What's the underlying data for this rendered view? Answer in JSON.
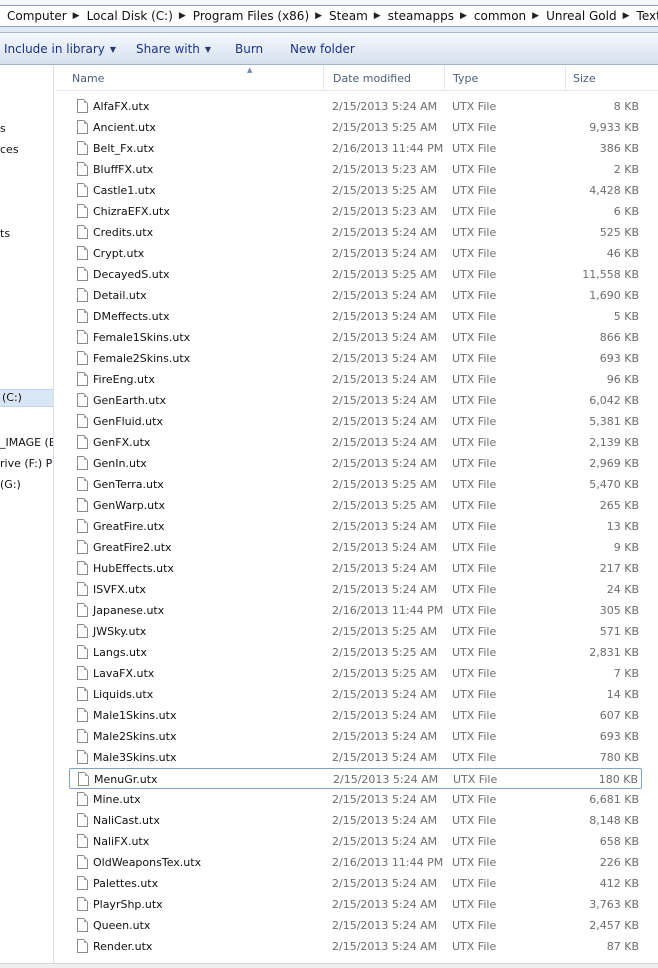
{
  "breadcrumb": [
    "Computer",
    "Local Disk (C:)",
    "Program Files (x86)",
    "Steam",
    "steamapps",
    "common",
    "Unreal Gold",
    "Textures"
  ],
  "commands": [
    {
      "label": "Include in library",
      "dropdown": true
    },
    {
      "label": "Share with",
      "dropdown": true
    },
    {
      "label": "Burn",
      "dropdown": false
    },
    {
      "label": "New folder",
      "dropdown": false
    }
  ],
  "nav": {
    "items": [
      {
        "label": "s"
      },
      {
        "label": "ces"
      },
      {
        "label": "ts"
      },
      {
        "label": "(C:)",
        "selected": true
      },
      {
        "label": "_IMAGE (E"
      },
      {
        "label": "rive (F:) Pl"
      },
      {
        "label": "(G:)"
      }
    ]
  },
  "columns": {
    "name": "Name",
    "date": "Date modified",
    "type": "Type",
    "size": "Size"
  },
  "files": [
    {
      "name": "AlfaFX.utx",
      "date": "2/15/2013 5:24 AM",
      "type": "UTX File",
      "size": "8 KB"
    },
    {
      "name": "Ancient.utx",
      "date": "2/15/2013 5:25 AM",
      "type": "UTX File",
      "size": "9,933 KB"
    },
    {
      "name": "Belt_Fx.utx",
      "date": "2/16/2013 11:44 PM",
      "type": "UTX File",
      "size": "386 KB"
    },
    {
      "name": "BluffFX.utx",
      "date": "2/15/2013 5:23 AM",
      "type": "UTX File",
      "size": "2 KB"
    },
    {
      "name": "Castle1.utx",
      "date": "2/15/2013 5:25 AM",
      "type": "UTX File",
      "size": "4,428 KB"
    },
    {
      "name": "ChizraEFX.utx",
      "date": "2/15/2013 5:23 AM",
      "type": "UTX File",
      "size": "6 KB"
    },
    {
      "name": "Credits.utx",
      "date": "2/15/2013 5:24 AM",
      "type": "UTX File",
      "size": "525 KB"
    },
    {
      "name": "Crypt.utx",
      "date": "2/15/2013 5:24 AM",
      "type": "UTX File",
      "size": "46 KB"
    },
    {
      "name": "DecayedS.utx",
      "date": "2/15/2013 5:25 AM",
      "type": "UTX File",
      "size": "11,558 KB"
    },
    {
      "name": "Detail.utx",
      "date": "2/15/2013 5:24 AM",
      "type": "UTX File",
      "size": "1,690 KB"
    },
    {
      "name": "DMeffects.utx",
      "date": "2/15/2013 5:24 AM",
      "type": "UTX File",
      "size": "5 KB"
    },
    {
      "name": "Female1Skins.utx",
      "date": "2/15/2013 5:24 AM",
      "type": "UTX File",
      "size": "866 KB"
    },
    {
      "name": "Female2Skins.utx",
      "date": "2/15/2013 5:24 AM",
      "type": "UTX File",
      "size": "693 KB"
    },
    {
      "name": "FireEng.utx",
      "date": "2/15/2013 5:24 AM",
      "type": "UTX File",
      "size": "96 KB"
    },
    {
      "name": "GenEarth.utx",
      "date": "2/15/2013 5:24 AM",
      "type": "UTX File",
      "size": "6,042 KB"
    },
    {
      "name": "GenFluid.utx",
      "date": "2/15/2013 5:24 AM",
      "type": "UTX File",
      "size": "5,381 KB"
    },
    {
      "name": "GenFX.utx",
      "date": "2/15/2013 5:24 AM",
      "type": "UTX File",
      "size": "2,139 KB"
    },
    {
      "name": "GenIn.utx",
      "date": "2/15/2013 5:24 AM",
      "type": "UTX File",
      "size": "2,969 KB"
    },
    {
      "name": "GenTerra.utx",
      "date": "2/15/2013 5:25 AM",
      "type": "UTX File",
      "size": "5,470 KB"
    },
    {
      "name": "GenWarp.utx",
      "date": "2/15/2013 5:25 AM",
      "type": "UTX File",
      "size": "265 KB"
    },
    {
      "name": "GreatFire.utx",
      "date": "2/15/2013 5:24 AM",
      "type": "UTX File",
      "size": "13 KB"
    },
    {
      "name": "GreatFire2.utx",
      "date": "2/15/2013 5:24 AM",
      "type": "UTX File",
      "size": "9 KB"
    },
    {
      "name": "HubEffects.utx",
      "date": "2/15/2013 5:24 AM",
      "type": "UTX File",
      "size": "217 KB"
    },
    {
      "name": "ISVFX.utx",
      "date": "2/15/2013 5:24 AM",
      "type": "UTX File",
      "size": "24 KB"
    },
    {
      "name": "Japanese.utx",
      "date": "2/16/2013 11:44 PM",
      "type": "UTX File",
      "size": "305 KB"
    },
    {
      "name": "JWSky.utx",
      "date": "2/15/2013 5:25 AM",
      "type": "UTX File",
      "size": "571 KB"
    },
    {
      "name": "Langs.utx",
      "date": "2/15/2013 5:25 AM",
      "type": "UTX File",
      "size": "2,831 KB"
    },
    {
      "name": "LavaFX.utx",
      "date": "2/15/2013 5:25 AM",
      "type": "UTX File",
      "size": "7 KB"
    },
    {
      "name": "Liquids.utx",
      "date": "2/15/2013 5:24 AM",
      "type": "UTX File",
      "size": "14 KB"
    },
    {
      "name": "Male1Skins.utx",
      "date": "2/15/2013 5:24 AM",
      "type": "UTX File",
      "size": "607 KB"
    },
    {
      "name": "Male2Skins.utx",
      "date": "2/15/2013 5:24 AM",
      "type": "UTX File",
      "size": "693 KB"
    },
    {
      "name": "Male3Skins.utx",
      "date": "2/15/2013 5:24 AM",
      "type": "UTX File",
      "size": "780 KB"
    },
    {
      "name": "MenuGr.utx",
      "date": "2/15/2013 5:24 AM",
      "type": "UTX File",
      "size": "180 KB",
      "focused": true
    },
    {
      "name": "Mine.utx",
      "date": "2/15/2013 5:24 AM",
      "type": "UTX File",
      "size": "6,681 KB"
    },
    {
      "name": "NaliCast.utx",
      "date": "2/15/2013 5:24 AM",
      "type": "UTX File",
      "size": "8,148 KB"
    },
    {
      "name": "NaliFX.utx",
      "date": "2/15/2013 5:24 AM",
      "type": "UTX File",
      "size": "658 KB"
    },
    {
      "name": "OldWeaponsTex.utx",
      "date": "2/16/2013 11:44 PM",
      "type": "UTX File",
      "size": "226 KB"
    },
    {
      "name": "Palettes.utx",
      "date": "2/15/2013 5:24 AM",
      "type": "UTX File",
      "size": "412 KB"
    },
    {
      "name": "PlayrShp.utx",
      "date": "2/15/2013 5:24 AM",
      "type": "UTX File",
      "size": "3,763 KB"
    },
    {
      "name": "Queen.utx",
      "date": "2/15/2013 5:24 AM",
      "type": "UTX File",
      "size": "2,457 KB"
    },
    {
      "name": "Render.utx",
      "date": "2/15/2013 5:24 AM",
      "type": "UTX File",
      "size": "87 KB"
    }
  ]
}
